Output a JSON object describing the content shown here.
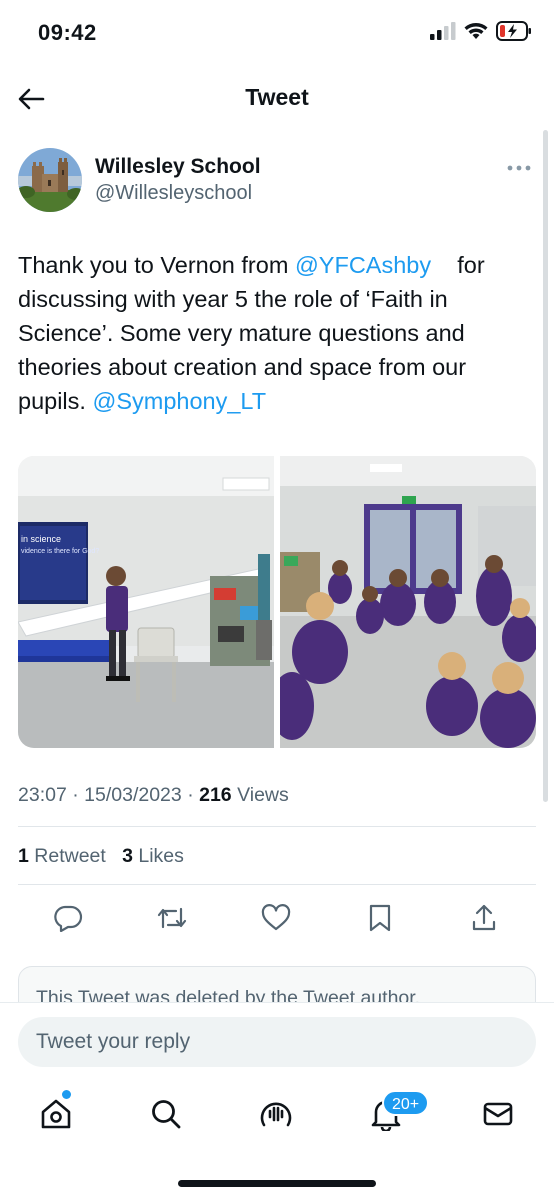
{
  "status_bar": {
    "time": "09:42",
    "signal_icon": "cellular-signal-icon",
    "wifi_icon": "wifi-icon",
    "battery_icon": "battery-low-charging-icon"
  },
  "header": {
    "title": "Tweet",
    "back_icon": "back-arrow-icon"
  },
  "author": {
    "name": "Willesley School",
    "handle": "@Willesleyschool"
  },
  "tweet": {
    "text_part1": "Thank you to Vernon from ",
    "mention1": "@YFCAshby",
    "text_part2": "    for discussing with year 5 the role of ‘Faith in Science’. Some very mature questions and theories about creation and space from our pupils. ",
    "mention2": "@Symphony_LT",
    "slide_title": "in science",
    "slide_text": "vidence is there for God?"
  },
  "meta": {
    "time": "23:07",
    "date": "15/03/2023",
    "views_count": "216",
    "views_label": "Views"
  },
  "stats": {
    "retweets_count": "1",
    "retweets_label": "Retweet",
    "likes_count": "3",
    "likes_label": "Likes"
  },
  "actions": [
    "reply-icon",
    "retweet-icon",
    "like-icon",
    "bookmark-icon",
    "share-icon"
  ],
  "deleted_notice": "This Tweet was deleted by the Tweet author.",
  "reply": {
    "placeholder": "Tweet your reply"
  },
  "tabs": {
    "home_icon": "home-icon",
    "search_icon": "search-icon",
    "spaces_icon": "spaces-icon",
    "notifications_icon": "bell-icon",
    "notifications_badge": "20+",
    "messages_icon": "mail-icon"
  },
  "colors": {
    "accent": "#1d9bf0",
    "text_primary": "#0f1419",
    "text_secondary": "#536471",
    "school_uniform": "#4a2d7a"
  }
}
